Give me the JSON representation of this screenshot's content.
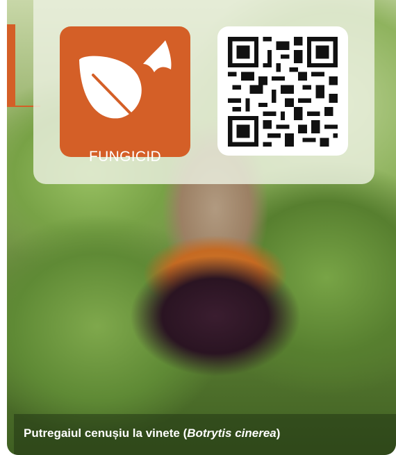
{
  "badge": {
    "label": "FUNGICID",
    "icon": "leaf-and-spore-icon",
    "color": "#d45f27"
  },
  "qr": {
    "icon": "qr-code-icon"
  },
  "caption": {
    "prefix": "Putregaiul cenușiu la vinete (",
    "species": "Botrytis cinerea",
    "suffix": ")"
  }
}
